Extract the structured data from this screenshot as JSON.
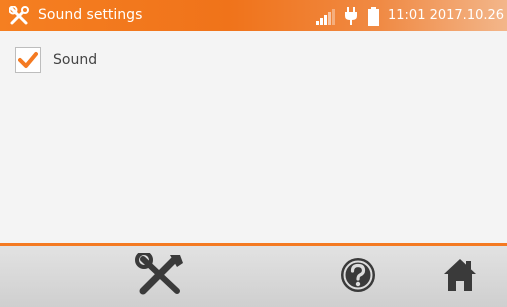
{
  "header": {
    "title": "Sound settings",
    "datetime": "11:01 2017.10.26",
    "icons": [
      "tools-icon",
      "signal-icon",
      "plug-icon",
      "battery-icon"
    ]
  },
  "settings": {
    "sound": {
      "label": "Sound",
      "checked": true
    }
  },
  "toolbar": {
    "buttons": [
      "tools-icon",
      "help-icon",
      "home-icon"
    ]
  },
  "colors": {
    "accent": "#f47a22",
    "header_start": "#f57f21",
    "toolbar": "#d8d8d8",
    "icon": "#3a3a3a"
  }
}
